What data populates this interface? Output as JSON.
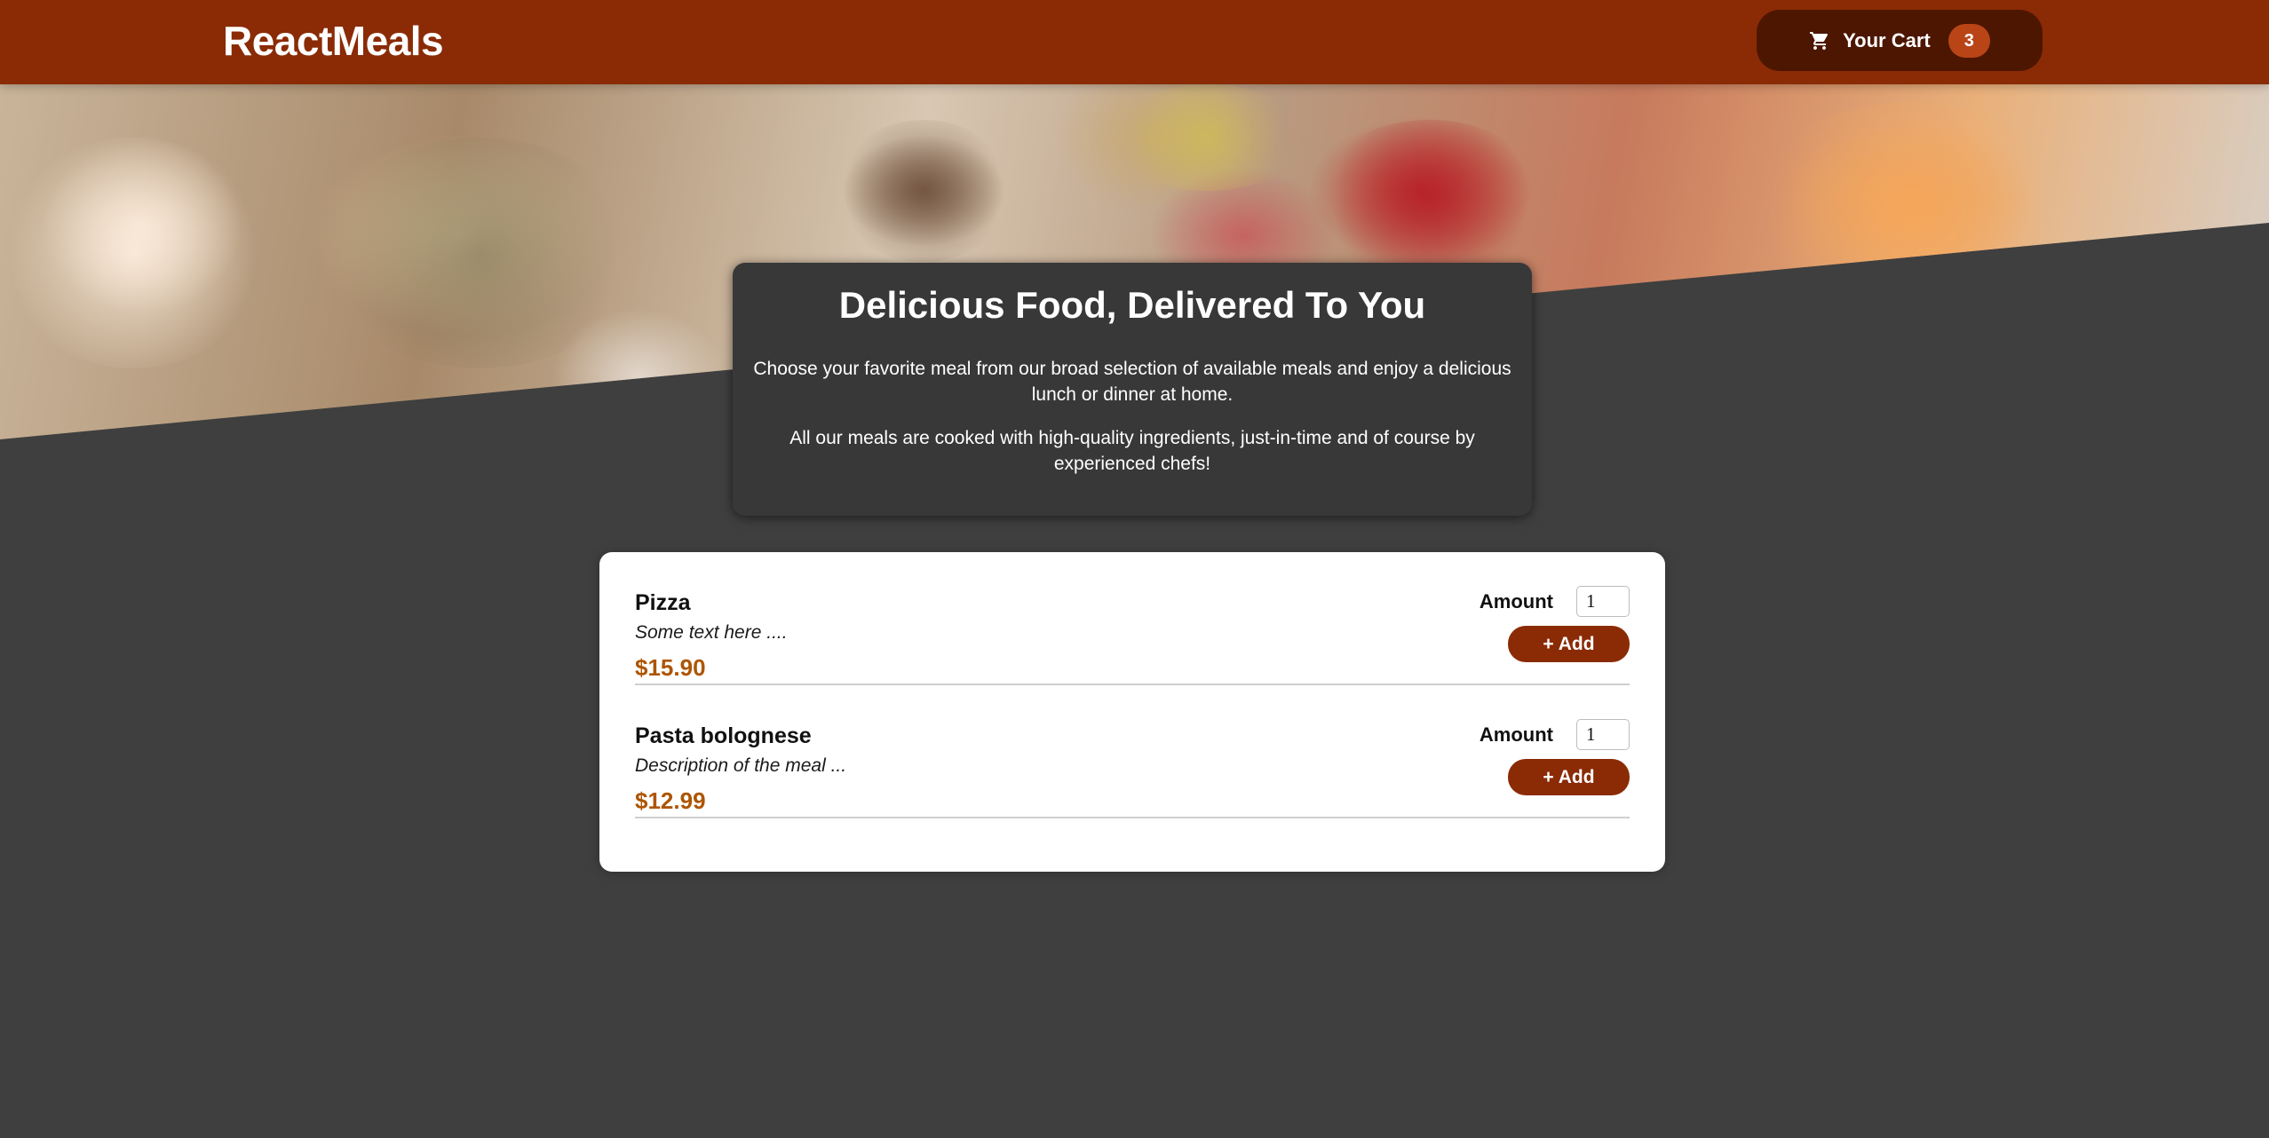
{
  "header": {
    "brand": "ReactMeals",
    "cart": {
      "label": "Your Cart",
      "count": "3",
      "icon": "cart-icon"
    }
  },
  "hero": {
    "image": "meals-table-image"
  },
  "summary": {
    "title": "Delicious Food, Delivered To You",
    "paragraph1": "Choose your favorite meal from our broad selection of available meals and enjoy a delicious lunch or dinner at home.",
    "paragraph2": "All our meals are cooked with high-quality ingredients, just-in-time and of course by experienced chefs!"
  },
  "meals": [
    {
      "name": "Pizza",
      "description": "Some text here ....",
      "price": "$15.90",
      "amount_label": "Amount",
      "amount_value": "1",
      "add_label": "+ Add"
    },
    {
      "name": "Pasta bolognese",
      "description": "Description of the meal ...",
      "price": "$12.99",
      "amount_label": "Amount",
      "amount_value": "1",
      "add_label": "+ Add"
    }
  ],
  "colors": {
    "header": "#8a2b06",
    "cart_button": "#4d1601",
    "cart_badge": "#b94517",
    "page_background": "#3f3f3f",
    "summary_background": "#383838",
    "price": "#ad5502",
    "add_button": "#8a2b06"
  }
}
